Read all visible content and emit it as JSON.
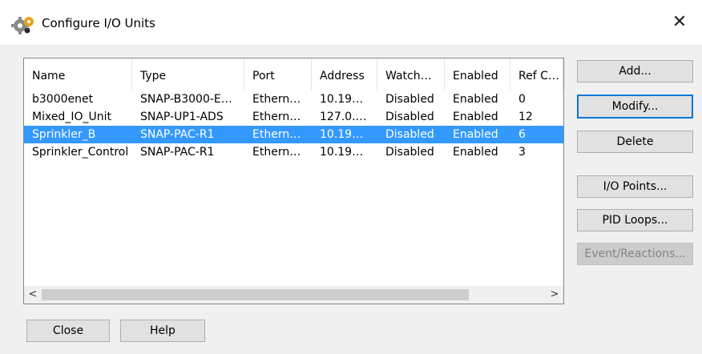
{
  "window": {
    "title": "Configure I/O Units",
    "close_glyph": "✕"
  },
  "columns": [
    "Name",
    "Type",
    "Port",
    "Address",
    "Watch…",
    "Enabled",
    "Ref C…"
  ],
  "rows": [
    {
      "name": "b3000enet",
      "type": "SNAP-B3000-E…",
      "port": "Ethern…",
      "address": "10.19…",
      "watch": "Disabled",
      "enabled": "Enabled",
      "ref": "0",
      "selected": false
    },
    {
      "name": "Mixed_IO_Unit",
      "type": "SNAP-UP1-ADS",
      "port": "Ethern…",
      "address": "127.0.…",
      "watch": "Disabled",
      "enabled": "Enabled",
      "ref": "12",
      "selected": false
    },
    {
      "name": "Sprinkler_B",
      "type": "SNAP-PAC-R1",
      "port": "Ethern…",
      "address": "10.19…",
      "watch": "Disabled",
      "enabled": "Enabled",
      "ref": "6",
      "selected": true
    },
    {
      "name": "Sprinkler_Control",
      "type": "SNAP-PAC-R1",
      "port": "Ethern…",
      "address": "10.19…",
      "watch": "Disabled",
      "enabled": "Enabled",
      "ref": "3",
      "selected": false
    }
  ],
  "buttons": {
    "add": "Add...",
    "modify": "Modify...",
    "delete": "Delete",
    "io_points": "I/O Points...",
    "pid_loops": "PID Loops...",
    "event_reactions": "Event/Reactions...",
    "close": "Close",
    "help": "Help"
  },
  "scrollbar": {
    "left_arrow": "<",
    "right_arrow": ">"
  },
  "colors": {
    "selection": "#3399ff",
    "default_button_border": "#0078d7"
  }
}
